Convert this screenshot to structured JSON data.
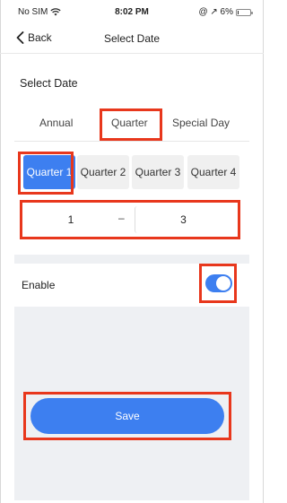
{
  "status_bar": {
    "carrier": "No SIM",
    "time": "8:02 PM",
    "battery_text": "@ ↗ 6%",
    "battery_level": 0.06
  },
  "nav": {
    "back_label": "Back",
    "title": "Select Date"
  },
  "section": {
    "title": "Select Date"
  },
  "tabs": [
    {
      "label": "Annual",
      "selected": false
    },
    {
      "label": "Quarter",
      "selected": true
    },
    {
      "label": "Special Day",
      "selected": false
    }
  ],
  "quarters": [
    {
      "label": "Quarter 1",
      "selected": true
    },
    {
      "label": "Quarter 2",
      "selected": false
    },
    {
      "label": "Quarter 3",
      "selected": false
    },
    {
      "label": "Quarter 4",
      "selected": false
    }
  ],
  "range": {
    "start": "1",
    "separator": "–",
    "end": "3"
  },
  "enable": {
    "label": "Enable",
    "on": true
  },
  "save_label": "Save",
  "colors": {
    "accent": "#3d7ff0",
    "highlight": "#e8371c",
    "panel": "#eef0f3"
  }
}
